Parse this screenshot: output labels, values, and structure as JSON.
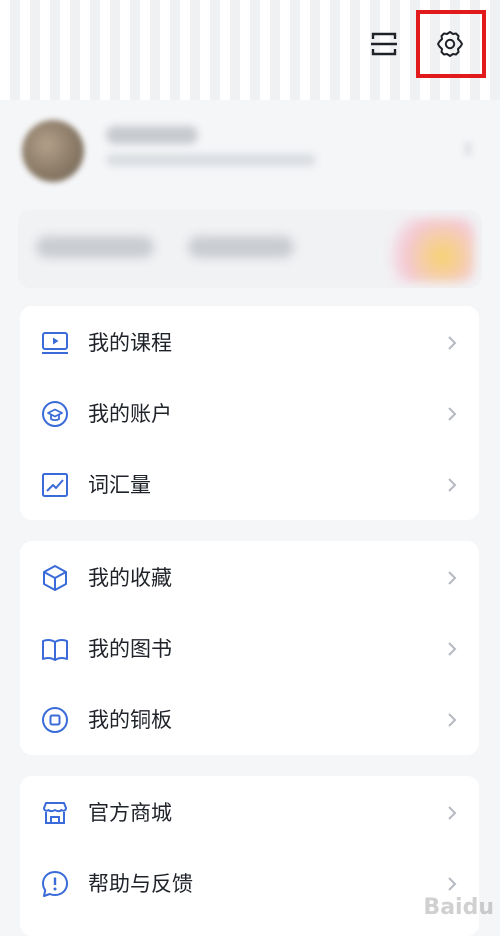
{
  "topbar": {
    "scan_icon": "scan-icon",
    "settings_icon": "gear-icon",
    "highlight_color": "#e11b1b"
  },
  "colors": {
    "accent": "#3a6bd8",
    "text": "#1f2329",
    "chevron": "#b5b9c0"
  },
  "menu_groups": [
    {
      "items": [
        {
          "label": "我的课程",
          "icon": "course-play-icon"
        },
        {
          "label": "我的账户",
          "icon": "account-cap-icon"
        },
        {
          "label": "词汇量",
          "icon": "vocabulary-chart-icon"
        }
      ]
    },
    {
      "items": [
        {
          "label": "我的收藏",
          "icon": "collection-cube-icon"
        },
        {
          "label": "我的图书",
          "icon": "book-icon"
        },
        {
          "label": "我的铜板",
          "icon": "coin-icon"
        }
      ]
    },
    {
      "items": [
        {
          "label": "官方商城",
          "icon": "store-icon"
        },
        {
          "label": "帮助与反馈",
          "icon": "help-feedback-icon"
        }
      ]
    }
  ],
  "watermark": "Baidu"
}
